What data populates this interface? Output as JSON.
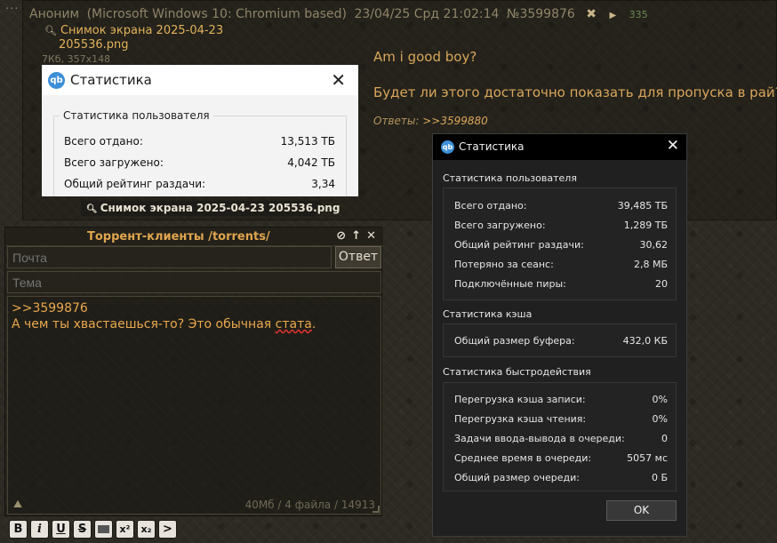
{
  "post": {
    "dots": "···",
    "author": "Аноним",
    "client": "(Microsoft Windows 10: Chromium based)",
    "datetime": "23/04/25 Срд 21:02:14",
    "number": "№3599876",
    "reply_count": "335",
    "file_name_line1": "Снимок экрана 2025-04-23",
    "file_name_line2": "205536.png",
    "file_meta": "7Кб, 357x148",
    "thumb_caption": "Снимок экрана 2025-04-23 205536.png",
    "text_line1": "Am i good boy?",
    "text_line2": "Будет ли этого достаточно показать для пропуска в рай?",
    "replies_label": "Ответы:",
    "reply_link": ">>3599880"
  },
  "thumb_window": {
    "logo": "qb",
    "title": "Статистика",
    "group_title": "Статистика пользователя",
    "rows": [
      {
        "label": "Всего отдано:",
        "value": "13,513 ТБ"
      },
      {
        "label": "Всего загружено:",
        "value": "4,042 ТБ"
      },
      {
        "label": "Общий рейтинг раздачи:",
        "value": "3,34"
      }
    ]
  },
  "form": {
    "title": "Торрент-клиенты /torrents/",
    "email_placeholder": "Почта",
    "subject_placeholder": "Тема",
    "reply_button": "Ответ",
    "text_line1": ">>3599876",
    "text_line2_a": "А чем ты хвастаешься-то? Это обычная ",
    "text_line2_err": "стата",
    "text_line2_b": ".",
    "info": "40Мб / 4 файла / 14913",
    "toolbar": [
      "B",
      "i",
      "U",
      "S",
      "",
      "x²",
      "x₂",
      ">"
    ]
  },
  "stats_window": {
    "logo": "qb",
    "title": "Статистика",
    "sections": [
      {
        "title": "Статистика пользователя",
        "rows": [
          {
            "label": "Всего отдано:",
            "value": "39,485 ТБ"
          },
          {
            "label": "Всего загружено:",
            "value": "1,289 ТБ"
          },
          {
            "label": "Общий рейтинг раздачи:",
            "value": "30,62"
          },
          {
            "label": "Потеряно за сеанс:",
            "value": "2,8 МБ"
          },
          {
            "label": "Подключённые пиры:",
            "value": "20"
          }
        ]
      },
      {
        "title": "Статистика кэша",
        "rows": [
          {
            "label": "Общий размер буфера:",
            "value": "432,0 КБ"
          }
        ]
      },
      {
        "title": "Статистика быстродействия",
        "rows": [
          {
            "label": "Перегрузка кэша записи:",
            "value": "0%"
          },
          {
            "label": "Перегрузка кэша чтения:",
            "value": "0%"
          },
          {
            "label": "Задачи ввода-вывода в очереди:",
            "value": "0"
          },
          {
            "label": "Среднее время в очереди:",
            "value": "5057 мс"
          },
          {
            "label": "Общий размер очереди:",
            "value": "0 Б"
          }
        ]
      }
    ],
    "ok_button": "OK"
  },
  "colors": {
    "accent": "#e9a84e",
    "reply_count": "#6f8c55",
    "qb_logo": "#3d8fd6"
  }
}
